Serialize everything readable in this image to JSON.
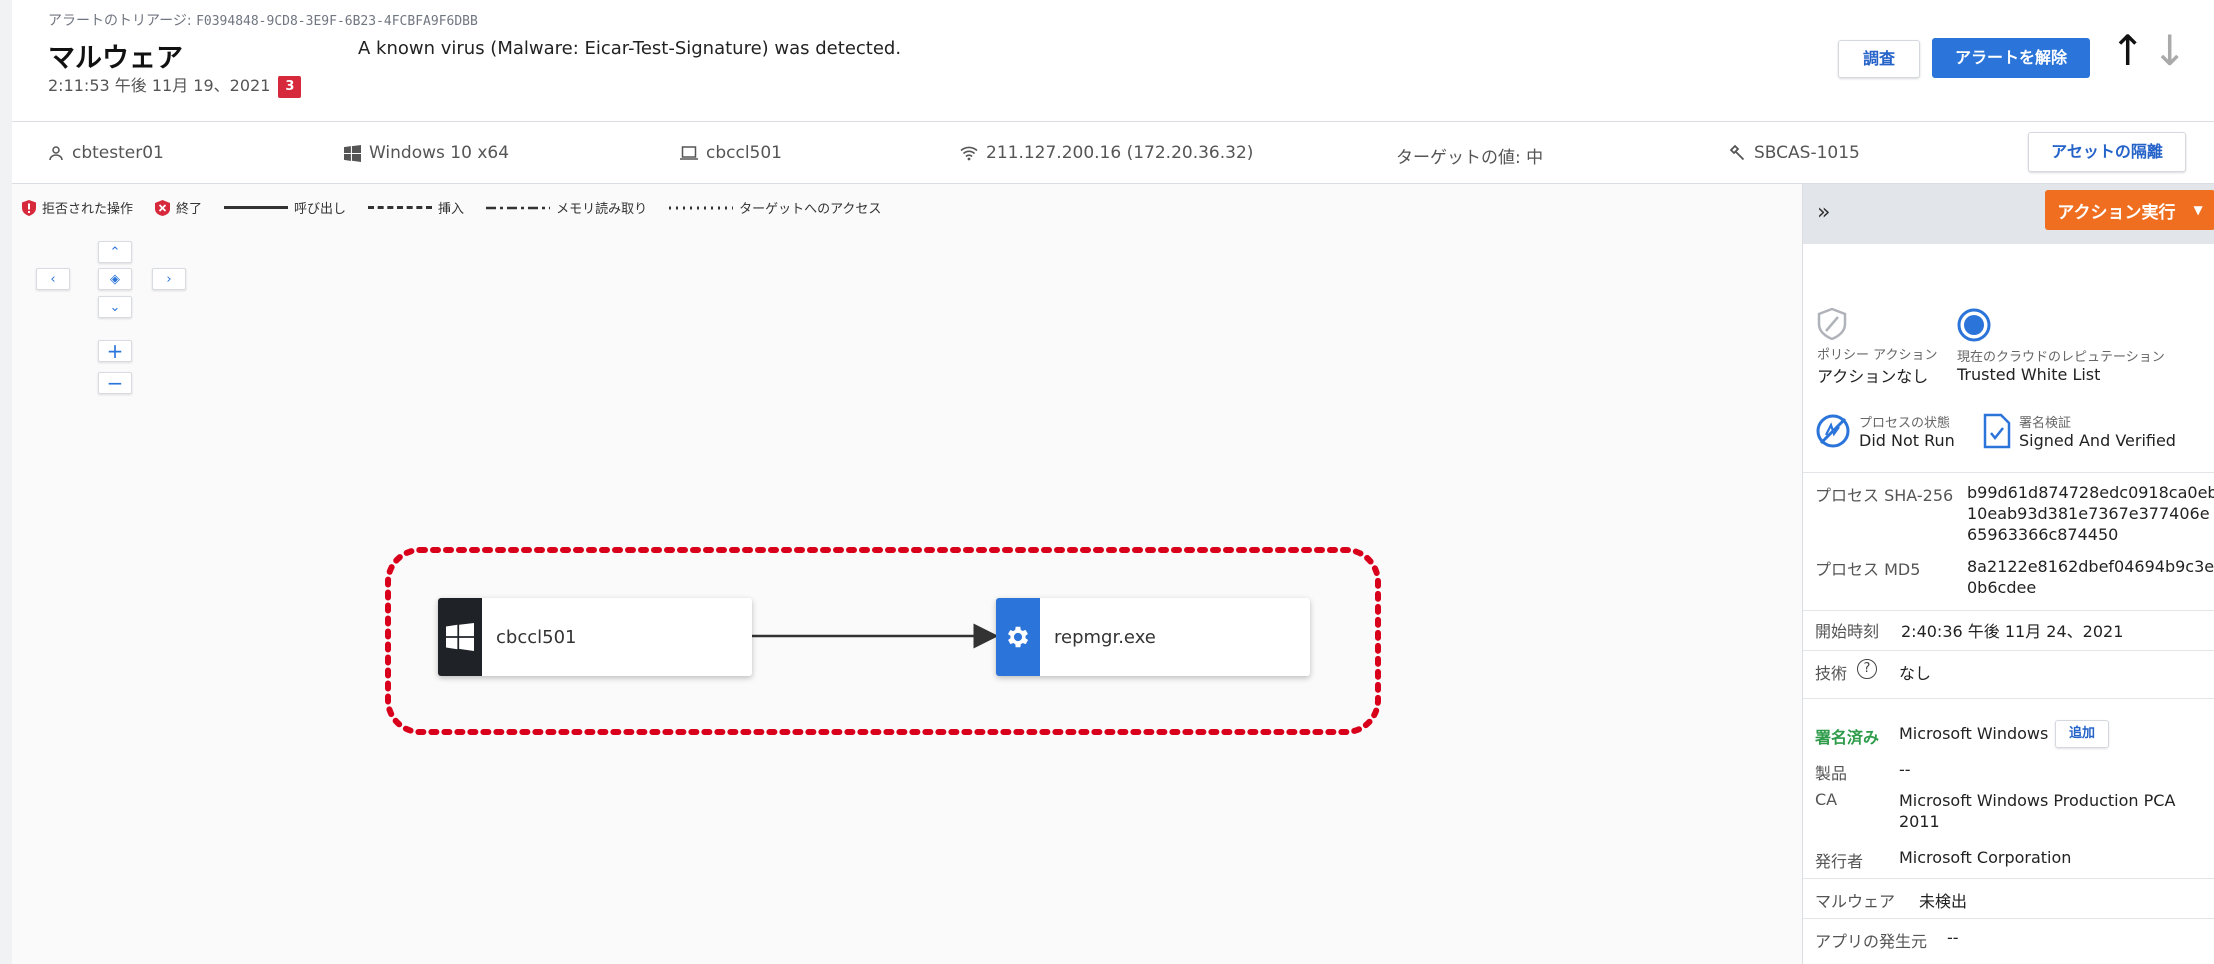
{
  "header": {
    "triage_label": "アラートのトリアージ:",
    "triage_id": "F0394848-9CD8-3E9F-6B23-4FCBFA9F6DBB",
    "title": "マルウェア",
    "timestamp": "2:11:53 午後 11月 19、2021",
    "severity": "3",
    "description": "A known virus (Malware: Eicar-Test-Signature) was detected.",
    "investigate_label": "調査",
    "dismiss_label": "アラートを解除",
    "up_arrow": "↑",
    "down_arrow": "↓"
  },
  "infobar": {
    "user": "cbtester01",
    "os": "Windows 10 x64",
    "device": "cbccl501",
    "ip": "211.127.200.16 (172.20.36.32)",
    "target": "ターゲットの値: 中",
    "policy": "SBCAS-1015",
    "quarantine_label": "アセットの隔離"
  },
  "legend": {
    "denied": "拒否された操作",
    "terminated": "終了",
    "invoke": "呼び出し",
    "inject": "挿入",
    "memory_read": "メモリ読み取り",
    "target_access": "ターゲットへのアクセス"
  },
  "graph": {
    "node_source": "cbccl501",
    "node_target": "repmgr.exe"
  },
  "panel": {
    "action_label": "アクション実行",
    "policy_action_label": "ポリシー アクション",
    "policy_action_value": "アクションなし",
    "reputation_label": "現在のクラウドのレピュテーション",
    "reputation_value": "Trusted White List",
    "process_state_label": "プロセスの状態",
    "process_state_value": "Did Not Run",
    "signature_label": "署名検証",
    "signature_value": "Signed And Verified",
    "sha256_label": "プロセス SHA-256",
    "sha256_lines": [
      "b99d61d874728edc0918ca0eb",
      "10eab93d381e7367e377406e",
      "65963366c874450"
    ],
    "md5_label": "プロセス MD5",
    "md5_lines": [
      "8a2122e8162dbef04694b9c3e",
      "0b6cdee"
    ],
    "start_label": "開始時刻",
    "start_value": "2:40:36 午後 11月 24、2021",
    "technique_label": "技術",
    "technique_value": "なし",
    "signed_label": "署名済み",
    "signed_value": "Microsoft Windows",
    "add_label": "追加",
    "product_label": "製品",
    "product_value": "--",
    "ca_label": "CA",
    "ca_lines": [
      "Microsoft Windows Production PCA",
      "2011"
    ],
    "publisher_label": "発行者",
    "publisher_value": "Microsoft Corporation",
    "malware_label": "マルウェア",
    "malware_value": "未検出",
    "app_origin_label": "アプリの発生元",
    "app_origin_value": "--"
  },
  "colors": {
    "primary": "#2b74d9",
    "action": "#f06e1f",
    "badge": "#d6293b",
    "signed": "#2e9c4a",
    "highlight": "#d9001b"
  }
}
